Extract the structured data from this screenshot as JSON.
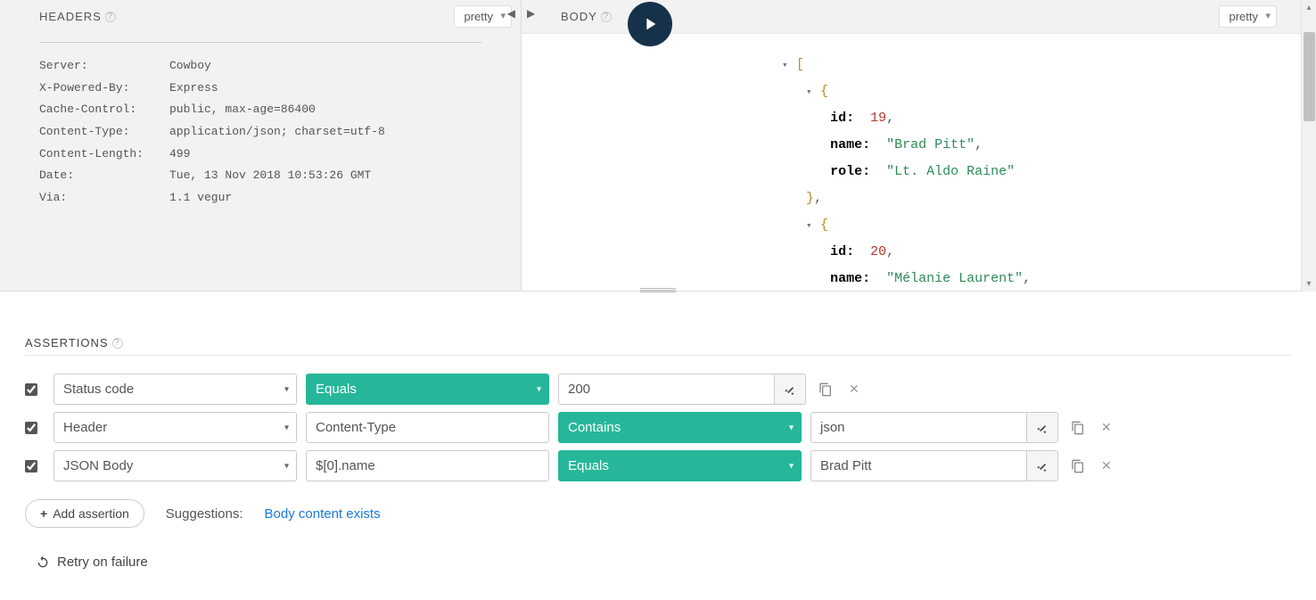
{
  "headers_panel": {
    "title": "HEADERS",
    "format": "pretty",
    "rows": [
      {
        "key": "Server:",
        "value": "Cowboy"
      },
      {
        "key": "X-Powered-By:",
        "value": "Express"
      },
      {
        "key": "Cache-Control:",
        "value": "public, max-age=86400"
      },
      {
        "key": "Content-Type:",
        "value": "application/json; charset=utf-8"
      },
      {
        "key": "Content-Length:",
        "value": "499"
      },
      {
        "key": "Date:",
        "value": "Tue, 13 Nov 2018 10:53:26 GMT"
      },
      {
        "key": "Via:",
        "value": "1.1 vegur"
      }
    ]
  },
  "body_panel": {
    "title": "BODY",
    "format": "pretty",
    "json_items": [
      {
        "id": 19,
        "name": "Brad Pitt",
        "role": "Lt. Aldo Raine"
      },
      {
        "id": 20,
        "name": "Mélanie Laurent"
      }
    ]
  },
  "assertions": {
    "title": "ASSERTIONS",
    "rows": [
      {
        "checked": true,
        "source": "Status code",
        "property": null,
        "comparison": "Equals",
        "target": "200"
      },
      {
        "checked": true,
        "source": "Header",
        "property": "Content-Type",
        "comparison": "Contains",
        "target": "json"
      },
      {
        "checked": true,
        "source": "JSON Body",
        "property": "$[0].name",
        "comparison": "Equals",
        "target": "Brad Pitt"
      }
    ],
    "add_label": "Add assertion",
    "suggest_label": "Suggestions:",
    "suggest_link": "Body content exists",
    "retry_label": "Retry on failure"
  }
}
